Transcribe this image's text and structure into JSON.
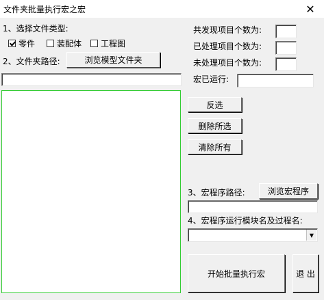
{
  "window": {
    "title": "文件夹批量执行宏之宏",
    "close_glyph": "✕"
  },
  "file_type": {
    "label": "1、选择文件类型:",
    "options": [
      {
        "label": "零件",
        "checked": true
      },
      {
        "label": "装配体",
        "checked": false
      },
      {
        "label": "工程图",
        "checked": false
      }
    ]
  },
  "folder": {
    "label": "2、文件夹路径:",
    "browse_label": "浏览模型文件夹",
    "path_value": ""
  },
  "stats": {
    "found_label": "共发现项目个数为:",
    "found_value": "",
    "processed_label": "已处理项目个数为:",
    "processed_value": "",
    "unprocessed_label": "未处理项目个数为:",
    "unprocessed_value": "",
    "macro_ran_label": "宏已运行:",
    "macro_ran_value": ""
  },
  "actions": {
    "invert_label": "反选",
    "delete_selected_label": "删除所选",
    "clear_all_label": "清除所有"
  },
  "macro": {
    "path_label": "3、宏程序路径:",
    "browse_label": "浏览宏程序",
    "path_value": "",
    "module_label": "4、宏程序运行模块名及过程名:",
    "module_value": ""
  },
  "footer": {
    "start_label": "开始批量执行宏",
    "exit_label": "退 出"
  }
}
